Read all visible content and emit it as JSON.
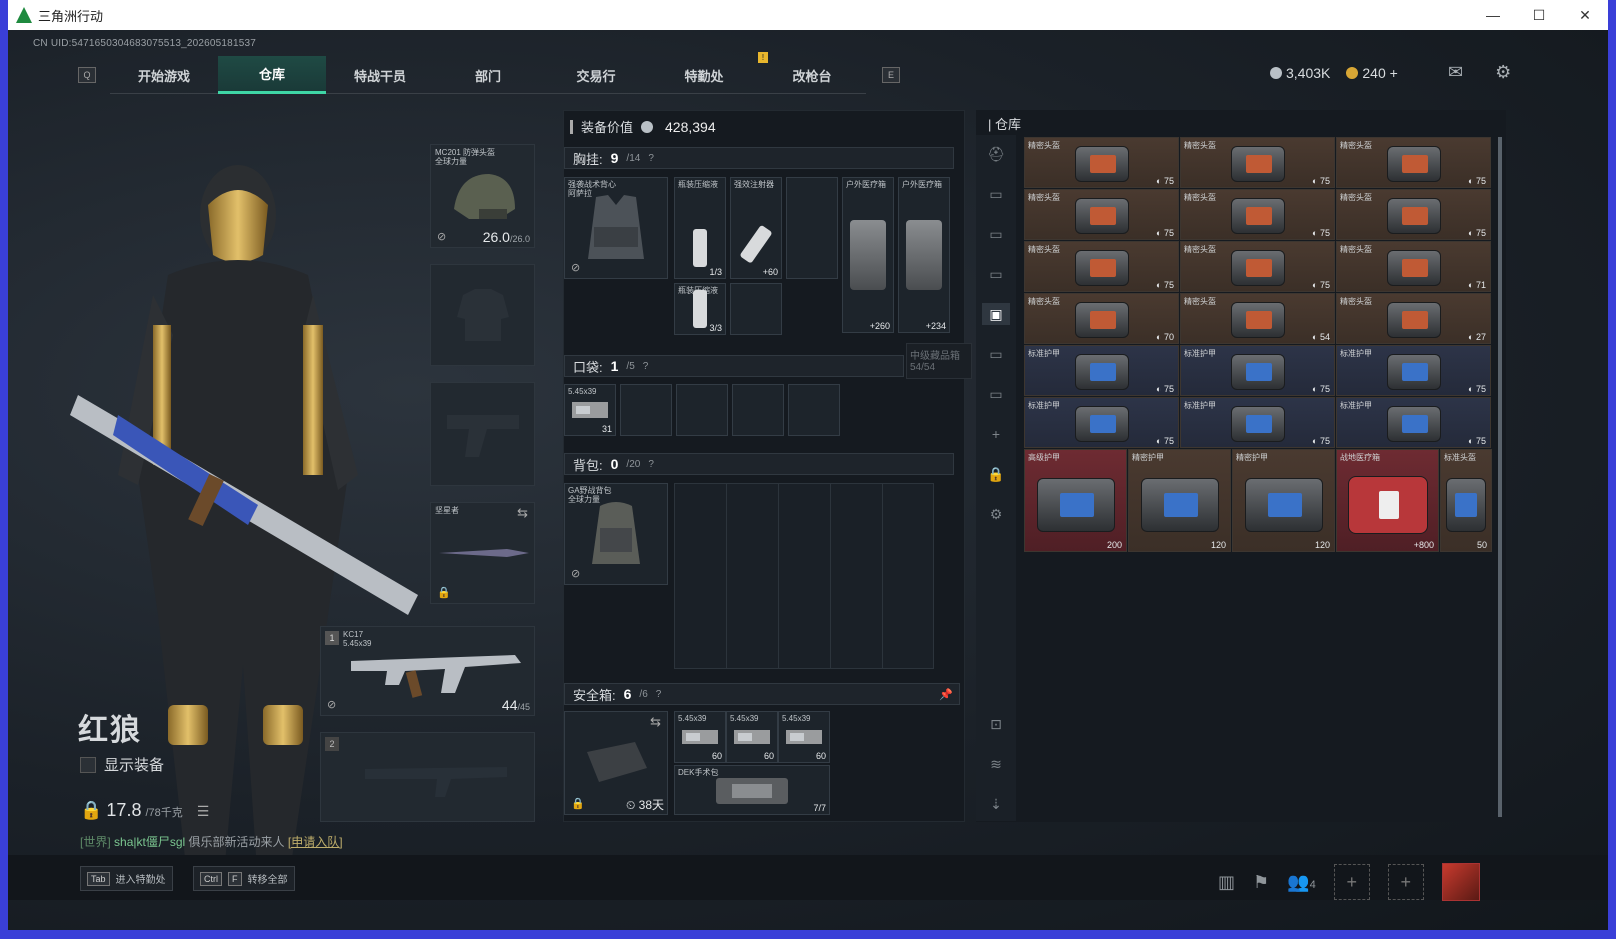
{
  "window": {
    "title": "三角洲行动"
  },
  "uid": "CN UID:5471650304683075513_202605181537",
  "nav": {
    "key_left": "Q",
    "key_right": "E",
    "tabs": [
      "开始游戏",
      "仓库",
      "特战干员",
      "部门",
      "交易行",
      "特勤处",
      "改枪台"
    ]
  },
  "currency": {
    "silver": "3,403K",
    "gold": "240",
    "gold_plus": "+"
  },
  "character": {
    "name": "红狼",
    "show_equipment": "显示装备"
  },
  "weight": {
    "value": "17.8",
    "max": "/78千克"
  },
  "chat": {
    "channel": "[世界]",
    "user": "sha|kt僵尸sgl",
    "message": "俱乐部新活动来人",
    "link": "[申请入队]"
  },
  "hints": [
    {
      "keys": [
        "Tab"
      ],
      "label": "进入特勤处"
    },
    {
      "keys": [
        "Ctrl",
        "F"
      ],
      "label": "转移全部"
    }
  ],
  "party_count": "4",
  "gear": {
    "helmet": {
      "name": "MC201 防弹头盔\n全球力量",
      "durability": "26.0",
      "max": "/26.0"
    },
    "melee": {
      "name": "坚星者"
    },
    "weapon1": {
      "slot": "1",
      "name": "KC17",
      "ammo_type": "5.45x39",
      "ammo": "44",
      "ammo_max": "/45"
    },
    "weapon2": {
      "slot": "2"
    }
  },
  "loadout": {
    "value_label": "装备价值",
    "value": "428,394",
    "chest": {
      "label": "胸挂:",
      "count": "9",
      "max": "/14",
      "rig_name": "强袭战术背心\n阿萨拉"
    },
    "chest_items": [
      {
        "label": "强效注射器",
        "value": "+60"
      },
      {
        "label": "瓶装压缩液",
        "value": "1/3"
      },
      {
        "label": "瓶装压缩液",
        "value": "3/3"
      },
      {
        "label": "户外医疗箱",
        "value": "+260"
      },
      {
        "label": "户外医疗箱",
        "value": "+234"
      }
    ],
    "tooltip": {
      "name": "中级藏品箱",
      "count": "54/54"
    },
    "pocket": {
      "label": "口袋:",
      "count": "1",
      "max": "/5",
      "item": "5.45x39",
      "item_count": "31"
    },
    "backpack": {
      "label": "背包:",
      "count": "0",
      "max": "/20",
      "name": "GA野战背包\n全球力量"
    },
    "safebox": {
      "label": "安全箱:",
      "count": "6",
      "max": "/6",
      "timer": "38天"
    },
    "safe_items": [
      {
        "label": "5.45x39",
        "value": "60"
      },
      {
        "label": "5.45x39",
        "value": "60"
      },
      {
        "label": "5.45x39",
        "value": "60"
      },
      {
        "label": "DEK手术包",
        "value": "7/7"
      }
    ]
  },
  "warehouse": {
    "title": "仓库",
    "rows": [
      [
        {
          "label": "精密头盔",
          "dur": "75"
        },
        {
          "label": "精密头盔",
          "dur": "75"
        },
        {
          "label": "精密头盔",
          "dur": "75"
        }
      ],
      [
        {
          "label": "精密头盔",
          "dur": "75"
        },
        {
          "label": "精密头盔",
          "dur": "75"
        },
        {
          "label": "精密头盔",
          "dur": "75"
        }
      ],
      [
        {
          "label": "精密头盔",
          "dur": "75"
        },
        {
          "label": "精密头盔",
          "dur": "75"
        },
        {
          "label": "精密头盔",
          "dur": "71"
        }
      ],
      [
        {
          "label": "精密头盔",
          "dur": "70"
        },
        {
          "label": "精密头盔",
          "dur": "54"
        },
        {
          "label": "精密头盔",
          "dur": "27"
        }
      ],
      [
        {
          "label": "标准护甲",
          "dur": "75"
        },
        {
          "label": "标准护甲",
          "dur": "75"
        },
        {
          "label": "标准护甲",
          "dur": "75"
        }
      ],
      [
        {
          "label": "标准护甲",
          "dur": "75"
        },
        {
          "label": "标准护甲",
          "dur": "75"
        },
        {
          "label": "标准护甲",
          "dur": "75"
        }
      ]
    ],
    "bottom_row": [
      {
        "label": "高级护甲",
        "dur": "200"
      },
      {
        "label": "精密护甲",
        "dur": "120"
      },
      {
        "label": "精密护甲",
        "dur": "120"
      },
      {
        "label": "战地医疗箱",
        "dur": "+800"
      },
      {
        "label": "标准头盔",
        "dur": "50"
      }
    ]
  },
  "colors": {
    "accent": "#3fd6a6",
    "item_brown": "#4a3a30",
    "item_blue": "#2d3448",
    "item_red": "#6e2b32",
    "notice": "#e8b62d"
  }
}
